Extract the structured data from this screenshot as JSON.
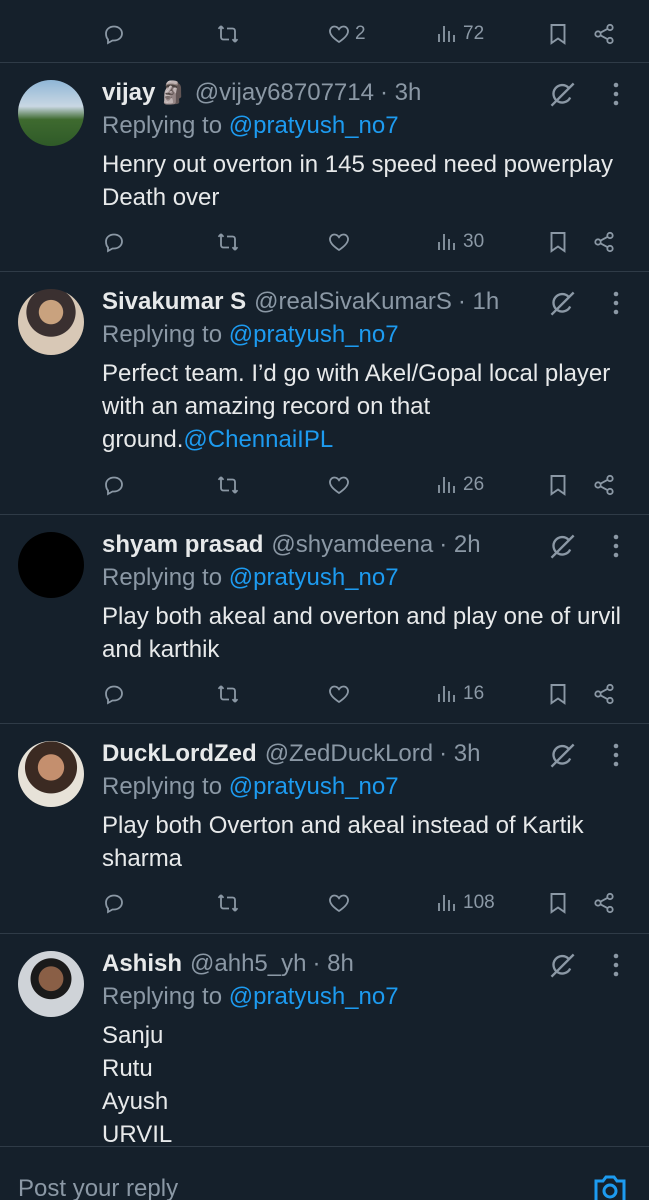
{
  "top_actions": {
    "likes": "2",
    "views": "72"
  },
  "tweets": [
    {
      "name": "vijay",
      "emoji": "🗿",
      "handle": "@vijay68707714",
      "time": "· 3h",
      "replying_prefix": "Replying to ",
      "replying_handle": "@pratyush_no7",
      "text": "Henry out overton in 145 speed need powerplay Death over",
      "views": "30"
    },
    {
      "name": "Sivakumar S",
      "handle": "@realSivaKumarS",
      "time": "· 1h",
      "replying_prefix": "Replying to ",
      "replying_handle": "@pratyush_no7",
      "text": "Perfect team. I’d go with Akel/Gopal  local player with an amazing record on that ground.",
      "mention": "@ChennaiIPL",
      "views": "26"
    },
    {
      "name": "shyam prasad",
      "handle": "@shyamdeena",
      "time": "· 2h",
      "replying_prefix": "Replying to ",
      "replying_handle": "@pratyush_no7",
      "text": "Play both akeal and overton and play one of urvil and karthik",
      "views": "16"
    },
    {
      "name": "DuckLordZed",
      "handle": "@ZedDuckLord",
      "time": "· 3h",
      "replying_prefix": "Replying to ",
      "replying_handle": "@pratyush_no7",
      "text": "Play both Overton and akeal instead of Kartik sharma",
      "views": "108"
    },
    {
      "name": "Ashish",
      "handle": "@ahh5_yh",
      "time": "· 8h",
      "replying_prefix": "Replying to ",
      "replying_handle": "@pratyush_no7",
      "lines": [
        "Sanju",
        "Rutu",
        "Ayush",
        "URVIL"
      ]
    }
  ],
  "reply_bar": {
    "placeholder": "Post your reply"
  },
  "colors": {
    "background": "#15202b",
    "accent": "#1d9bf0",
    "muted": "#8b98a5",
    "divider": "#2f3b47"
  }
}
